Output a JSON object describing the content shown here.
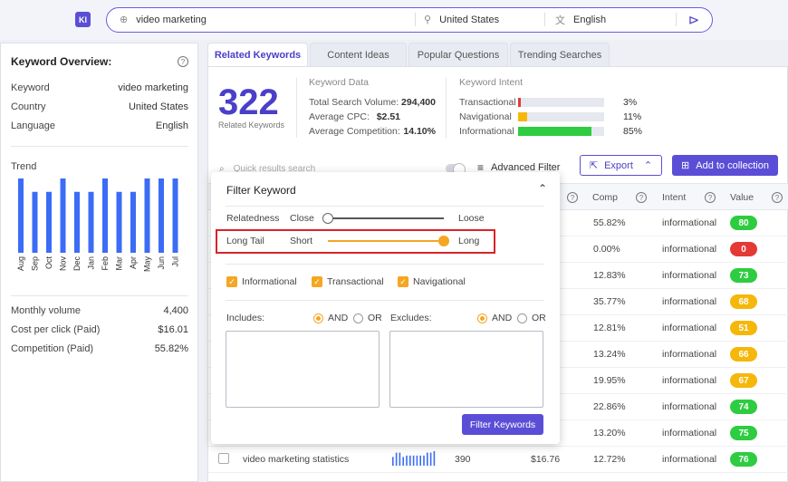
{
  "search": {
    "logo": "KI",
    "keyword": "video marketing",
    "country": "United States",
    "language": "English"
  },
  "overview": {
    "title": "Keyword Overview:",
    "rows": [
      {
        "label": "Keyword",
        "value": "video marketing"
      },
      {
        "label": "Country",
        "value": "United States"
      },
      {
        "label": "Language",
        "value": "English"
      }
    ],
    "trend_label": "Trend",
    "stats": [
      {
        "label": "Monthly volume",
        "value": "4,400"
      },
      {
        "label": "Cost per click (Paid)",
        "value": "$16.01"
      },
      {
        "label": "Competition (Paid)",
        "value": "55.82%"
      }
    ]
  },
  "chart_data": {
    "type": "bar",
    "categories": [
      "Aug",
      "Sep",
      "Oct",
      "Nov",
      "Dec",
      "Jan",
      "Feb",
      "Mar",
      "Apr",
      "May",
      "Jun",
      "Jul"
    ],
    "values": [
      100,
      82,
      82,
      100,
      82,
      82,
      100,
      82,
      82,
      100,
      100,
      100
    ],
    "title": "Trend",
    "color": "#3b6cf5"
  },
  "tabs": [
    "Related Keywords",
    "Content Ideas",
    "Popular Questions",
    "Trending Searches"
  ],
  "summary": {
    "count": "322",
    "count_label": "Related Keywords",
    "data_title": "Keyword Data",
    "data_rows": [
      {
        "label": "Total Search Volume:",
        "value": "294,400"
      },
      {
        "label": "Average CPC:",
        "value": "$2.51"
      },
      {
        "label": "Average Competition:",
        "value": "14.10%"
      }
    ],
    "intent_title": "Keyword Intent",
    "intents": [
      {
        "label": "Transactional",
        "pct": "3%",
        "frac": 0.03,
        "color": "#e53935"
      },
      {
        "label": "Navigational",
        "pct": "11%",
        "frac": 0.11,
        "color": "#f5b70a"
      },
      {
        "label": "Informational",
        "pct": "85%",
        "frac": 0.85,
        "color": "#2ecc40"
      }
    ]
  },
  "toolbar": {
    "quick_placeholder": "Quick results search",
    "advanced_filter": "Advanced Filter",
    "export": "Export",
    "add_collection": "Add to collection"
  },
  "table": {
    "headers": {
      "comp": "Comp",
      "intent": "Intent",
      "value": "Value"
    },
    "rows": [
      {
        "comp": "55.82%",
        "intent": "informational",
        "value": "80",
        "color": "#2ecc40"
      },
      {
        "comp": "0.00%",
        "intent": "informational",
        "value": "0",
        "color": "#e53935"
      },
      {
        "comp": "12.83%",
        "intent": "informational",
        "value": "73",
        "color": "#2ecc40"
      },
      {
        "comp": "35.77%",
        "intent": "informational",
        "value": "68",
        "color": "#f5b70a"
      },
      {
        "comp": "12.81%",
        "intent": "informational",
        "value": "51",
        "color": "#f5b70a"
      },
      {
        "comp": "13.24%",
        "intent": "informational",
        "value": "66",
        "color": "#f5b70a"
      },
      {
        "comp": "19.95%",
        "intent": "informational",
        "value": "67",
        "color": "#f5b70a"
      },
      {
        "comp": "22.86%",
        "intent": "informational",
        "value": "74",
        "color": "#2ecc40"
      },
      {
        "comp": "13.20%",
        "intent": "informational",
        "value": "75",
        "color": "#2ecc40"
      },
      {
        "keyword": "video marketing statistics",
        "volume": "390",
        "cpc": "$16.76",
        "comp": "12.72%",
        "intent": "informational",
        "value": "76",
        "color": "#2ecc40"
      }
    ]
  },
  "filter": {
    "title": "Filter Keyword",
    "relatedness": {
      "label": "Relatedness",
      "left": "Close",
      "right": "Loose",
      "level": 0
    },
    "longtail": {
      "label": "Long Tail",
      "left": "Short",
      "right": "Long",
      "level": 1
    },
    "checks": [
      "Informational",
      "Transactional",
      "Navigational"
    ],
    "includes": "Includes:",
    "excludes": "Excludes:",
    "and": "AND",
    "or": "OR",
    "apply": "Filter Keywords"
  }
}
